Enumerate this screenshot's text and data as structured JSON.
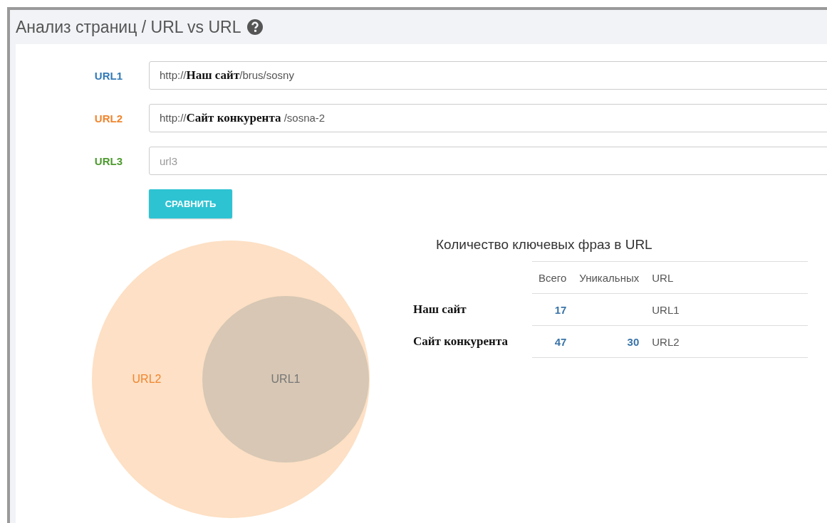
{
  "header": {
    "title": "Анализ страниц / URL vs URL"
  },
  "form": {
    "urls": [
      {
        "label": "URL1",
        "color": "#337ab7",
        "value": "http://**Наш сайт**/brus/sosny"
      },
      {
        "label": "URL2",
        "color": "#f0862f",
        "value": "http://**Сайт конкурента** /sosna-2"
      },
      {
        "label": "URL3",
        "color": "#4e9a2f",
        "placeholder": "url3"
      }
    ],
    "button": "СРАВНИТЬ"
  },
  "venn": {
    "sets": [
      {
        "kind": "outer",
        "label": "URL2",
        "color": "#fde0c5"
      },
      {
        "kind": "inner",
        "label": "URL1",
        "color": "#d7c7b4"
      }
    ]
  },
  "table": {
    "title": "Количество ключевых фраз в URL",
    "columns": [
      "Всего",
      "Уникальных",
      "URL"
    ],
    "rows": [
      {
        "name": "Наш сайт",
        "total": "17",
        "url": "URL1"
      },
      {
        "name": "Сайт конкурента",
        "total": "47",
        "unique": "30",
        "url": "URL2"
      }
    ]
  }
}
